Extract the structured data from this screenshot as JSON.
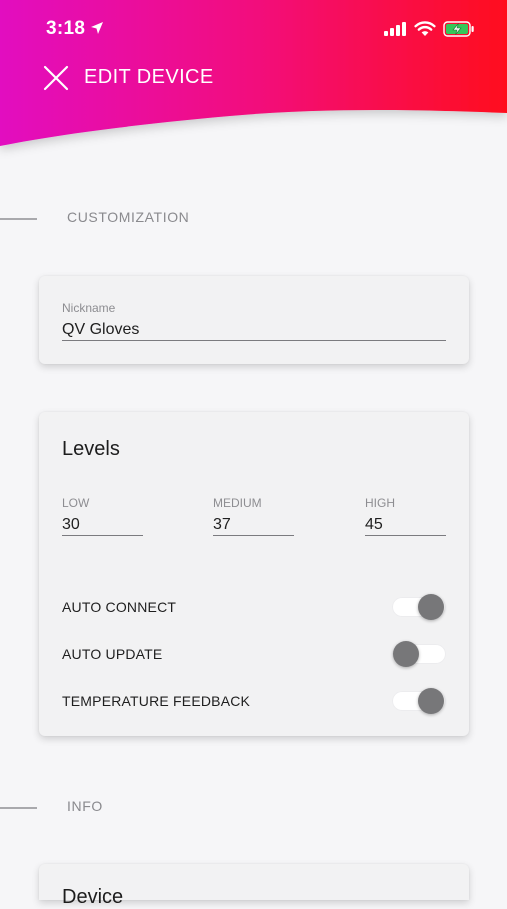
{
  "status_bar": {
    "time": "3:18"
  },
  "header": {
    "title": "EDIT DEVICE"
  },
  "sections": {
    "customization": "CUSTOMIZATION",
    "info": "INFO"
  },
  "nickname": {
    "label": "Nickname",
    "value": "QV Gloves"
  },
  "levels": {
    "title": "Levels",
    "low": {
      "label": "LOW",
      "value": "30"
    },
    "medium": {
      "label": "MEDIUM",
      "value": "37"
    },
    "high": {
      "label": "HIGH",
      "value": "45"
    }
  },
  "settings": {
    "auto_connect": {
      "label": "AUTO CONNECT",
      "on": true
    },
    "auto_update": {
      "label": "AUTO UPDATE",
      "on": false
    },
    "temperature_feedback": {
      "label": "TEMPERATURE FEEDBACK",
      "on": true
    }
  },
  "device_card": {
    "title": "Device"
  },
  "colors": {
    "gradient_start": "#e20cc0",
    "gradient_end": "#ff0a1e",
    "background": "#f6f6f8"
  }
}
